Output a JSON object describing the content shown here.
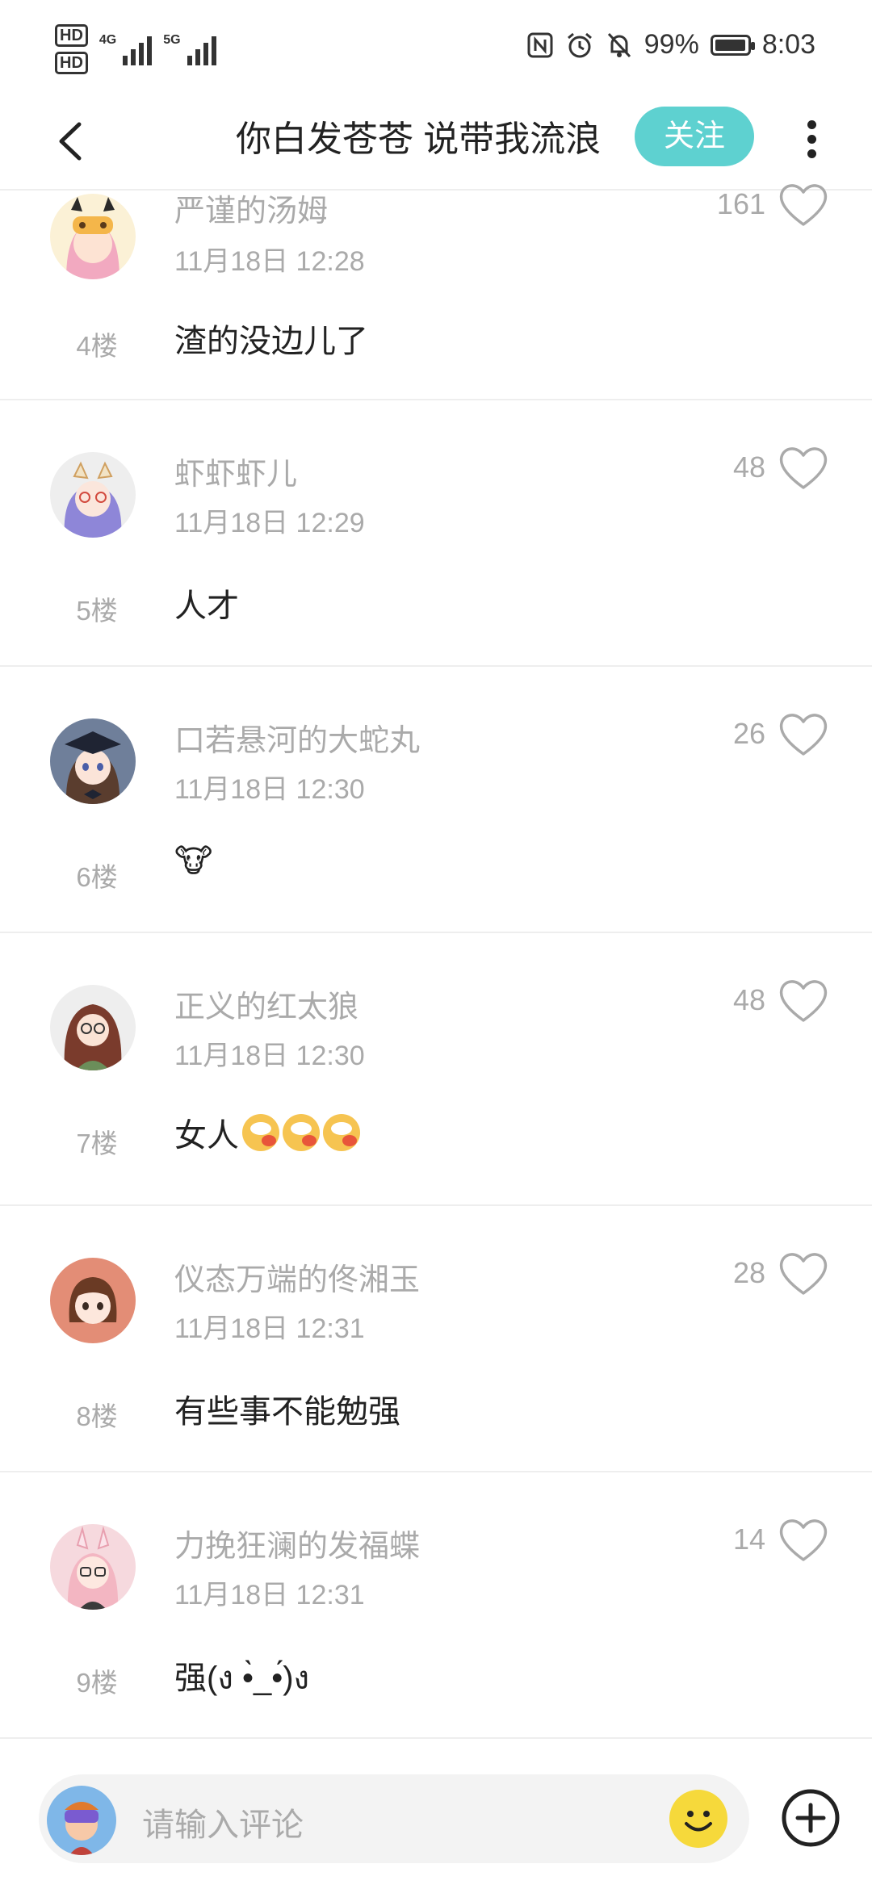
{
  "status": {
    "hd1": "HD",
    "hd2": "HD",
    "net1": "4G",
    "net2": "5G",
    "battery_pct": "99%",
    "battery_level": 0.99,
    "time": "8:03"
  },
  "header": {
    "title": "你白发苍苍 说带我流浪",
    "follow_label": "关注"
  },
  "comments": [
    {
      "name": "严谨的汤姆",
      "time": "11月18日 12:28",
      "likes": "161",
      "floor": "4楼",
      "text": "渣的没边儿了"
    },
    {
      "name": "虾虾虾儿",
      "time": "11月18日 12:29",
      "likes": "48",
      "floor": "5楼",
      "text": "人才"
    },
    {
      "name": "口若悬河的大蛇丸",
      "time": "11月18日 12:30",
      "likes": "26",
      "floor": "6楼",
      "text": "🐮"
    },
    {
      "name": "正义的红太狼",
      "time": "11月18日 12:30",
      "likes": "48",
      "floor": "7楼",
      "text": "女人"
    },
    {
      "name": "仪态万端的佟湘玉",
      "time": "11月18日 12:31",
      "likes": "28",
      "floor": "8楼",
      "text": "有些事不能勉强"
    },
    {
      "name": "力挽狂澜的发福蝶",
      "time": "11月18日 12:31",
      "likes": "14",
      "floor": "9楼",
      "text": "强(ง •̀_•́)ง"
    }
  ],
  "input": {
    "placeholder": "请输入评论"
  },
  "colors": {
    "accent": "#5ed1d0",
    "muted": "#aaaaaa",
    "divider": "#eeeeee",
    "emoji": "#f6d93b"
  }
}
